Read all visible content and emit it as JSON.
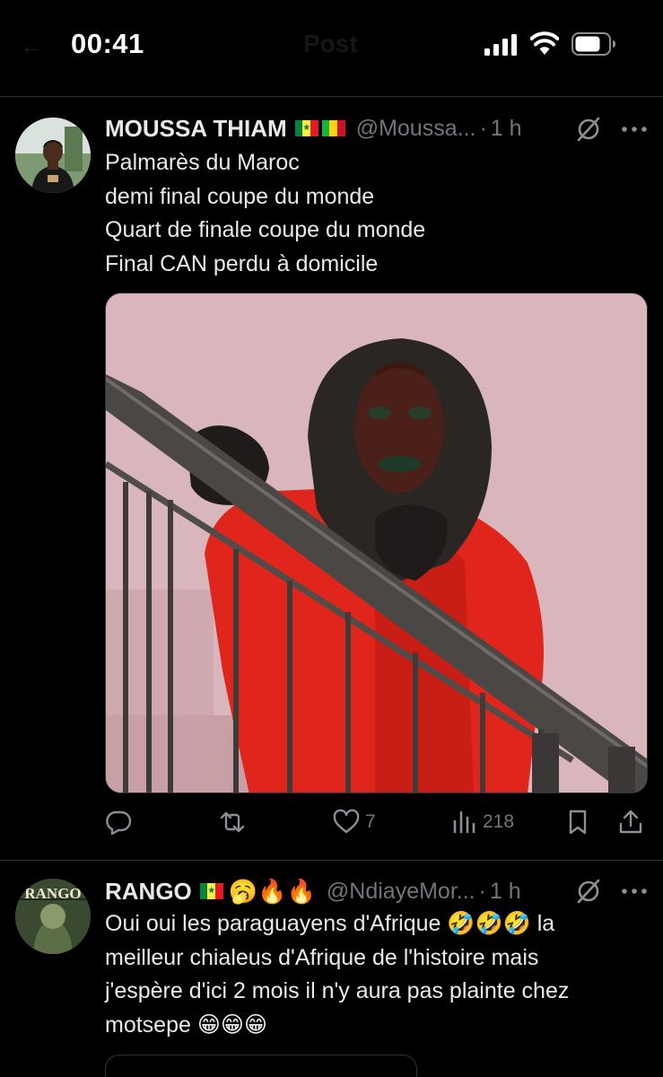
{
  "status_bar": {
    "time": "00:41",
    "back_label": "←",
    "title": "Post"
  },
  "tweets": [
    {
      "display_name": "MOUSSA THIAM",
      "handle": "@Moussa...",
      "separator": "·",
      "time_ago": "1 h",
      "text_lines": [
        "Palmarès du Maroc",
        "demi final coupe du monde",
        "Quart de finale coupe du monde",
        "Final CAN perdu à domicile"
      ],
      "stats": {
        "replies": "",
        "reposts": "",
        "likes": "7",
        "views": "218"
      }
    },
    {
      "display_name": "RANGO",
      "handle": "@NdiayeMor...",
      "separator": "·",
      "time_ago": "1 h",
      "emojis": "🥱🔥🔥",
      "avatar_text": "RANGO",
      "text_lines": [
        "Oui oui les paraguayens d'Afrique 🤣🤣🤣 la",
        "meilleur chialeus d'Afrique de l'histoire mais",
        "j'espère d'ici 2 mois il n'y aura pas plainte chez",
        "motsepe 😁😁😁"
      ]
    }
  ],
  "icons": [
    "signal-icon",
    "wifi-icon",
    "battery-icon",
    "grok-icon",
    "more-icon",
    "reply-icon",
    "repost-icon",
    "like-icon",
    "views-icon",
    "bookmark-icon",
    "share-icon"
  ],
  "colors": {
    "background": "#000000",
    "text": "#e7e9ea",
    "muted": "#71767b",
    "divider": "#2f3336",
    "flag_green": "#00853f",
    "flag_yellow": "#fdef42",
    "flag_red": "#e31b23"
  }
}
